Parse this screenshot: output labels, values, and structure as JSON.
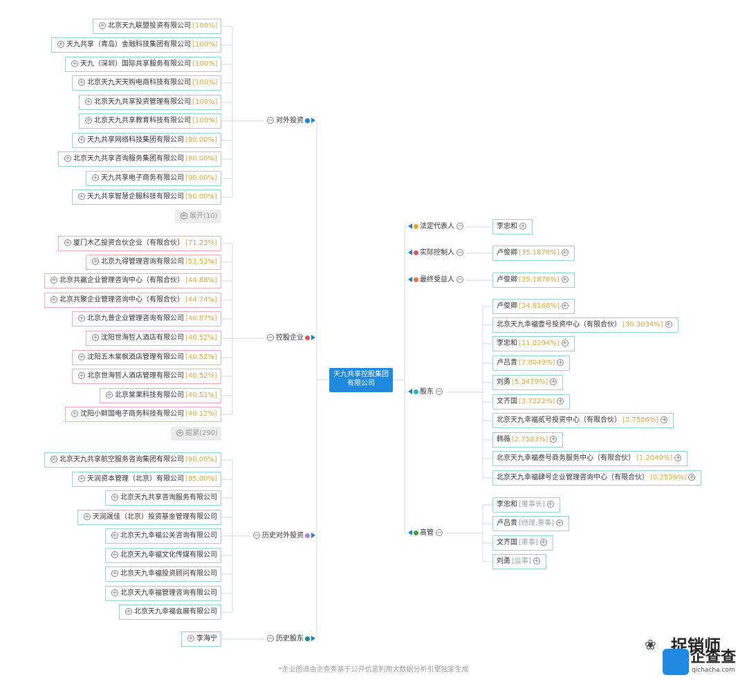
{
  "center": {
    "line1": "天九共享控股集团",
    "line2": "有限公司"
  },
  "colors": {
    "teal_border": "#8fd3cc",
    "red_border": "#f3aaaa",
    "percent": "#e8a93b",
    "center_bg": "#1f88df"
  },
  "left": {
    "investments": {
      "label": "对外投资",
      "dot_color": "#1a7fd6",
      "items": [
        {
          "name": "北京天九联盟投资有限公司",
          "pct": "[100%]"
        },
        {
          "name": "天九共享（青岛）金融科技集团有限公司",
          "pct": "[100%]"
        },
        {
          "name": "天九（深圳）国际共享服务有限公司",
          "pct": "[100%]"
        },
        {
          "name": "北京天九天天购电商科技有限公司",
          "pct": "[100%]"
        },
        {
          "name": "北京天九共享投资管理有限公司",
          "pct": "[100%]"
        },
        {
          "name": "北京天九共享教育科技有限公司",
          "pct": "[100%]"
        },
        {
          "name": "天九共享网络科技集团有限公司",
          "pct": "[90.00%]"
        },
        {
          "name": "北京天九共享咨询服务集团有限公司",
          "pct": "[90.00%]"
        },
        {
          "name": "天九共享电子商务有限公司",
          "pct": "[90.00%]"
        },
        {
          "name": "天九共享智慧企服科技有限公司",
          "pct": "[90.00%]"
        }
      ],
      "more": "展开(10)"
    },
    "holdings": {
      "label": "控股企业",
      "dot_color": "#e25555",
      "items": [
        {
          "name": "厦门木乙投资合伙企业（有限合伙）",
          "pct": "[71.23%]"
        },
        {
          "name": "北京九得管理咨询有限公司",
          "pct": "[53.53%]"
        },
        {
          "name": "北京共赢企业管理咨询中心（有限合伙）",
          "pct": "[44.88%]"
        },
        {
          "name": "北京共聚企业管理咨询中心（有限合伙）",
          "pct": "[44.74%]"
        },
        {
          "name": "北京九普企业管理咨询有限公司",
          "pct": "[40.87%]"
        },
        {
          "name": "沈阳世海哲人酒店有限公司",
          "pct": "[40.52%]"
        },
        {
          "name": "沈阳五木棠枫酒店管理有限公司",
          "pct": "[40.52%]"
        },
        {
          "name": "北京世海哲人酒店管理有限公司",
          "pct": "[40.52%]"
        },
        {
          "name": "北京棠果科技有限公司",
          "pct": "[40.52%]"
        },
        {
          "name": "沈阳小鲜国电子商务科技有限公司",
          "pct": "[40.12%]"
        }
      ],
      "more": "掘紧(290)"
    },
    "history_investments": {
      "label": "历史对外投资",
      "dot_color": "#b57ed8",
      "items": [
        {
          "name": "北京天九共享航空服务咨询集团有限公司",
          "pct": "[90.00%]"
        },
        {
          "name": "天润资本管理（北京）有限公司",
          "pct": "[95.00%]"
        },
        {
          "name": "北京天九共享咨询服务有限公司",
          "pct": ""
        },
        {
          "name": "天润晟佳（北京）投资基金管理有限公司",
          "pct": ""
        },
        {
          "name": "北京天九幸福公关咨询有限公司",
          "pct": ""
        },
        {
          "name": "北京天九幸福文化传媒有限公司",
          "pct": ""
        },
        {
          "name": "北京天九幸福投资顾问有限公司",
          "pct": ""
        },
        {
          "name": "北京天九幸福管理咨询有限公司",
          "pct": ""
        },
        {
          "name": "北京天九幸福会展有限公司",
          "pct": ""
        }
      ]
    },
    "history_shareholders": {
      "label": "历史股东",
      "dot_color": "#1a8a8a",
      "items": [
        {
          "name": "李海宁",
          "pct": ""
        }
      ]
    }
  },
  "right": {
    "legal_rep": {
      "label": "法定代表人",
      "dot_color": "#f0a020",
      "items": [
        {
          "name": "李忠和",
          "pct": ""
        }
      ]
    },
    "actual_controller": {
      "label": "实际控制人",
      "dot_color": "#e25555",
      "items": [
        {
          "name": "卢俊卿",
          "pct": "[35.1876%]"
        }
      ]
    },
    "beneficiary": {
      "label": "最终受益人",
      "dot_color": "#f07040",
      "items": [
        {
          "name": "卢俊卿",
          "pct": "[35.1876%]"
        }
      ]
    },
    "shareholders": {
      "label": "股东",
      "dot_color": "#20b0c8",
      "items": [
        {
          "name": "卢俊卿",
          "pct": "[34.8168%]"
        },
        {
          "name": "北京天九幸福壹号投资中心（有限合伙）",
          "pct": "[30.3034%]"
        },
        {
          "name": "李忠和",
          "pct": "[11.0294%]"
        },
        {
          "name": "卢吕贵",
          "pct": "[7.8049%]"
        },
        {
          "name": "刘勇",
          "pct": "[5.3479%]"
        },
        {
          "name": "文齐国",
          "pct": "[3.7222%]"
        },
        {
          "name": "北京天九幸福贰号投资中心（有限合伙）",
          "pct": "[2.7586%]"
        },
        {
          "name": "韩薇",
          "pct": "[2.7583%]"
        },
        {
          "name": "北京天九幸福叁号商务服务中心（有限合伙）",
          "pct": "[1.2049%]"
        },
        {
          "name": "北京天九幸福肆号企业管理咨询中心（有限合伙）",
          "pct": "[0.2536%]"
        }
      ]
    },
    "executives": {
      "label": "高管",
      "dot_color": "#3aa040",
      "items": [
        {
          "name": "李忠和",
          "role": "[董事长]"
        },
        {
          "name": "卢吕贵",
          "role": "[经理,董事]"
        },
        {
          "name": "文齐国",
          "role": "[董事]"
        },
        {
          "name": "刘勇",
          "role": "[监事]"
        }
      ]
    }
  },
  "footer": "*企业图谱由企查查基于公开信息利用大数据分析引擎独家生成",
  "brand": {
    "watermark": "捉销师",
    "logo": "企查查",
    "url": "qichacha.com"
  }
}
